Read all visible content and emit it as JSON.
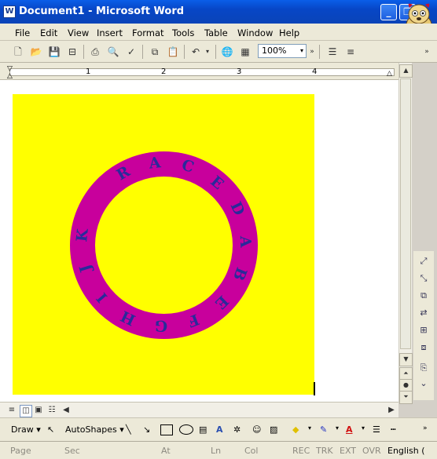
{
  "window": {
    "title": "Document1 - Microsoft Word"
  },
  "menu": [
    "File",
    "Edit",
    "View",
    "Insert",
    "Format",
    "Tools",
    "Table",
    "Window",
    "Help"
  ],
  "toolbar": {
    "zoom": "100%"
  },
  "ruler": {
    "numbers": [
      "1",
      "2",
      "3",
      "4"
    ]
  },
  "document": {
    "ring_letters": [
      "R",
      "A",
      "C",
      "E",
      "D",
      "A",
      "B",
      "E",
      "F",
      "G",
      "H",
      "I",
      "J",
      "K"
    ]
  },
  "draw_toolbar": {
    "draw": "Draw",
    "autoshapes": "AutoShapes"
  },
  "status": {
    "page": "Page",
    "sec": "Sec",
    "at": "At",
    "ln": "Ln",
    "col": "Col",
    "rec": "REC",
    "trk": "TRK",
    "ext": "EXT",
    "ovr": "OVR",
    "lang": "English ("
  },
  "colors": {
    "fill": "#ffff00",
    "ring": "#c8009c",
    "letters": "#2a2a9a"
  }
}
